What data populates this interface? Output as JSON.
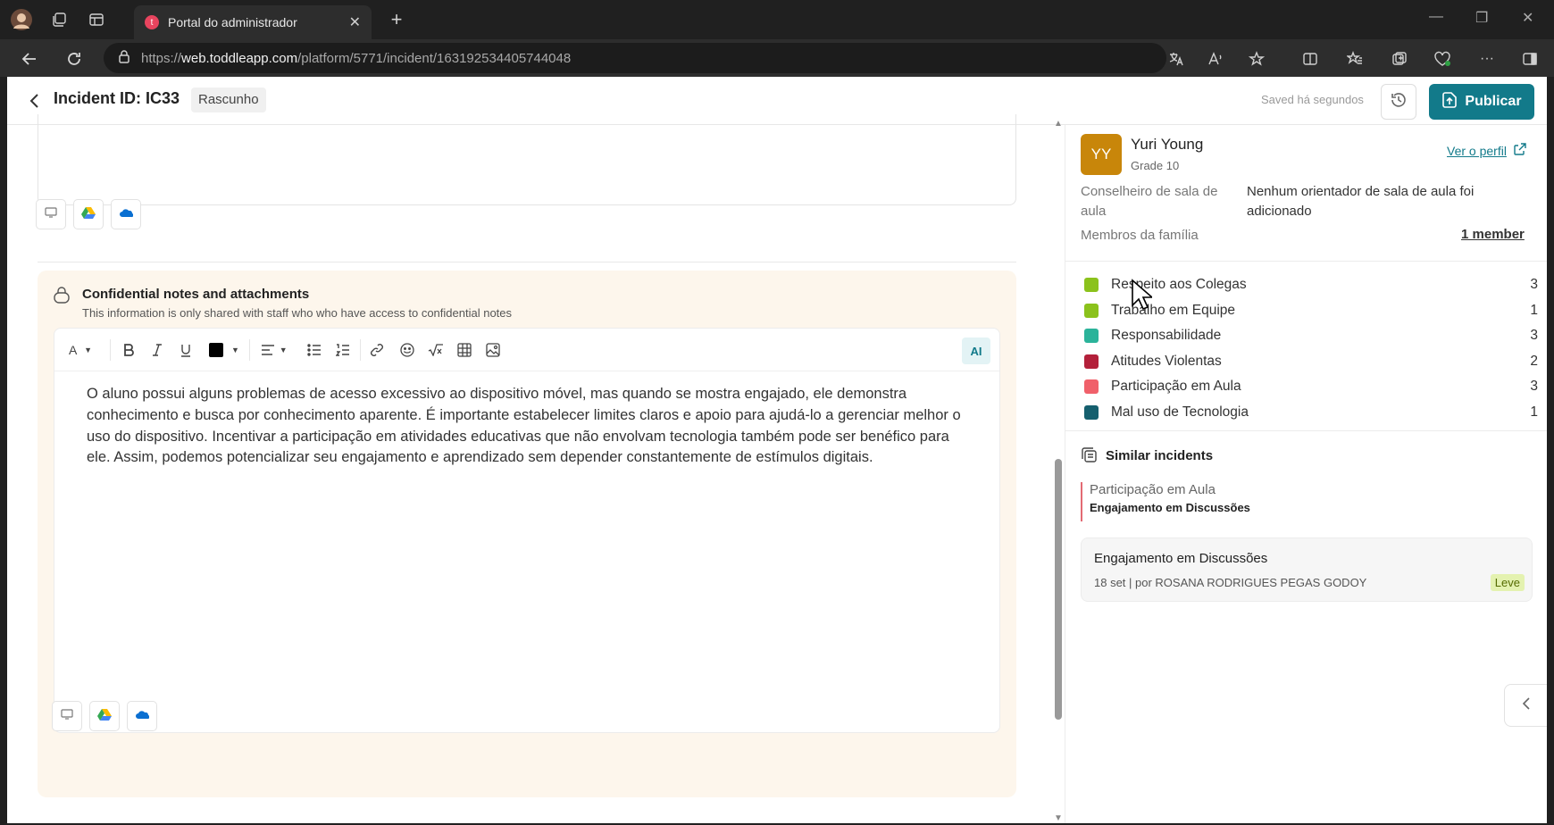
{
  "browser": {
    "tab_title": "Portal do administrador",
    "tab_favicon": "t",
    "url_prefix": "https://",
    "url_host": "web.toddleapp.com",
    "url_path": "/platform/5771/incident/163192534405744048"
  },
  "header": {
    "incident_id": "Incident ID: IC33",
    "status": "Rascunho",
    "saved_text": "Saved há segundos",
    "publish_label": "Publicar"
  },
  "confidential": {
    "title": "Confidential notes and attachments",
    "subtitle": "This information is only shared with staff who who have access to confidential notes",
    "ai_label": "AI",
    "toolbar_font_label": "A",
    "text": "O aluno possui alguns problemas de acesso excessivo ao dispositivo móvel, mas quando se mostra engajado, ele demonstra conhecimento e busca por conhecimento aparente. É importante estabelecer limites claros e apoio para ajudá-lo a gerenciar melhor o uso do dispositivo. Incentivar a participação em atividades educativas que não envolvam tecnologia também pode ser benéfico para ele. Assim, podemos potencializar seu engajamento e aprendizado sem depender constantemente de estímulos digitais."
  },
  "student": {
    "initials": "YY",
    "name": "Yuri Young",
    "grade": "Grade 10",
    "profile_link": "Ver o perfil",
    "counselor_label": "Conselheiro de sala de aula",
    "counselor_value": "Nenhum orientador de sala de aula foi adicionado",
    "family_label": "Membros da família",
    "family_value": "1 member",
    "avatar_color": "#c8860a"
  },
  "categories": [
    {
      "name": "Respeito aos Colegas",
      "count": "3",
      "color": "#8bc21c"
    },
    {
      "name": "Trabalho em Equipe",
      "count": "1",
      "color": "#8bc21c"
    },
    {
      "name": "Responsabilidade",
      "count": "3",
      "color": "#2bb39a"
    },
    {
      "name": "Atitudes Violentas",
      "count": "2",
      "color": "#b3203a"
    },
    {
      "name": "Participação em Aula",
      "count": "3",
      "color": "#f0606a"
    },
    {
      "name": "Mal uso de Tecnologia",
      "count": "1",
      "color": "#155f6e"
    }
  ],
  "similar": {
    "title": "Similar incidents",
    "highlight_category": "Participação em Aula",
    "highlight_sub": "Engajamento em Discussões",
    "card_title": "Engajamento em Discussões",
    "card_meta": "18 set | por ROSANA RODRIGUES PEGAS GODOY",
    "card_severity": "Leve"
  },
  "colors": {
    "accent": "#127a8a",
    "confidential_bg": "#fdf6ec",
    "severity_bg": "#e4f2b0"
  },
  "icons": [
    "back-icon",
    "history-icon",
    "publish-icon",
    "lock-icon",
    "monitor-icon",
    "google-drive-icon",
    "onedrive-icon",
    "bold-icon",
    "italic-icon",
    "underline-icon",
    "align-icon",
    "bullet-list-icon",
    "numbered-list-icon",
    "link-icon",
    "emoji-icon",
    "formula-icon",
    "table-icon",
    "image-icon",
    "external-link-icon",
    "similar-incidents-icon",
    "chevron-left-icon"
  ]
}
